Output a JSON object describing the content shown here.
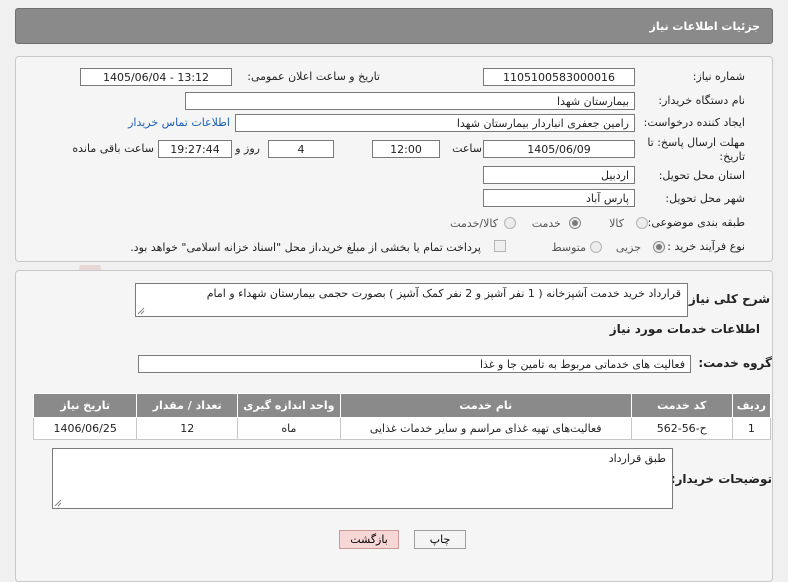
{
  "header": {
    "title": "جزئیات اطلاعات نیاز"
  },
  "form": {
    "need_number": {
      "label": "شماره نیاز:",
      "value": "1105100583000016"
    },
    "announce_datetime": {
      "label": "تاریخ و ساعت اعلان عمومی:",
      "value": "1405/06/04 - 13:12"
    },
    "buyer_org": {
      "label": "نام دستگاه خریدار:",
      "value": "بیمارستان شهدا"
    },
    "requester": {
      "label": "ایجاد کننده درخواست:",
      "value": "رامین جعفری انباردار بیمارستان شهدا",
      "contact_link": "اطلاعات تماس خریدار"
    },
    "deadline": {
      "label_line1": "مهلت ارسال پاسخ: تا",
      "label_line2": "تاریخ:",
      "date": "1405/06/09",
      "time_label": "ساعت",
      "time": "12:00",
      "days": "4",
      "days_label": "روز و",
      "remaining_time": "19:27:44",
      "remaining_label": "ساعت باقی مانده"
    },
    "province": {
      "label": "استان محل تحویل:",
      "value": "اردبیل"
    },
    "city": {
      "label": "شهر محل تحویل:",
      "value": "پارس آباد"
    },
    "category": {
      "label": "طبقه بندی موضوعی:",
      "options": [
        "کالا",
        "خدمت",
        "کالا/خدمت"
      ],
      "selected": "خدمت"
    },
    "purchase_type": {
      "label": "نوع فرآیند خرید :",
      "options": [
        "جزیی",
        "متوسط"
      ],
      "selected": "جزیی",
      "payment_note": "پرداخت تمام یا بخشی از مبلغ خرید،از محل \"اسناد خزانه اسلامی\" خواهد بود."
    }
  },
  "description": {
    "label": "شرح کلی نیاز:",
    "value": "قرارداد خرید خدمت آشپزخانه ( 1 نفر آشپز و 2 نفر کمک آشپز ) بصورت حجمی بیمارستان شهداء و امام"
  },
  "services": {
    "section_title": "اطلاعات خدمات مورد نیاز",
    "group_label": "گروه خدمت:",
    "group_value": "فعالیت های خدماتی مربوط به تامین جا و غذا",
    "columns": [
      "ردیف",
      "کد خدمت",
      "نام خدمت",
      "واحد اندازه گیری",
      "تعداد / مقدار",
      "تاریخ نیاز"
    ],
    "rows": [
      {
        "row": "1",
        "code": "ح-56-562",
        "name": "فعالیت‌های تهیه غذای مراسم و سایر خدمات غذایی",
        "unit": "ماه",
        "qty": "12",
        "date": "1406/06/25"
      }
    ]
  },
  "buyer_notes": {
    "label": "توضیحات خریدار:",
    "value": "طبق قرارداد"
  },
  "buttons": {
    "print": "چاپ",
    "back": "بازگشت"
  },
  "watermark": {
    "text": "AriaTender.net"
  },
  "colors": {
    "header_bg": "#8a8a8a",
    "link": "#1a5fb4",
    "back_button": "#f7d6d6"
  }
}
